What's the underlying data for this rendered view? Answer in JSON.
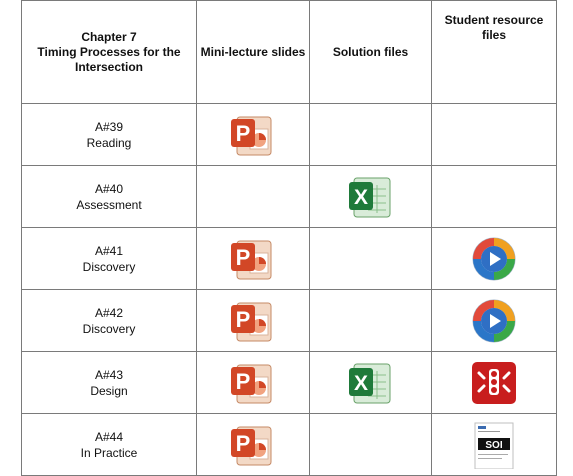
{
  "header": {
    "title_lines": [
      "Chapter 7",
      "Timing Processes for the",
      "Intersection"
    ],
    "col_slides": "Mini-lecture slides",
    "col_solutions": "Solution files",
    "col_resources_lines": [
      "Student resource",
      "files"
    ]
  },
  "rows": [
    {
      "id": "A#39",
      "label": "Reading",
      "slides": "powerpoint-icon",
      "solutions": "",
      "resources": ""
    },
    {
      "id": "A#40",
      "label": "Assessment",
      "slides": "",
      "solutions": "excel-icon",
      "resources": ""
    },
    {
      "id": "A#41",
      "label": "Discovery",
      "slides": "powerpoint-icon",
      "solutions": "",
      "resources": "media-player-icon"
    },
    {
      "id": "A#42",
      "label": "Discovery",
      "slides": "powerpoint-icon",
      "solutions": "",
      "resources": "media-player-icon"
    },
    {
      "id": "A#43",
      "label": "Design",
      "slides": "powerpoint-icon",
      "solutions": "excel-icon",
      "resources": "traffic-light-app-icon"
    },
    {
      "id": "A#44",
      "label": "In Practice",
      "slides": "powerpoint-icon",
      "solutions": "",
      "resources": "document-thumbnail-icon"
    }
  ],
  "colors": {
    "ppt": "#d24726",
    "excel": "#1f7a3a",
    "border": "#7a7a7a"
  }
}
